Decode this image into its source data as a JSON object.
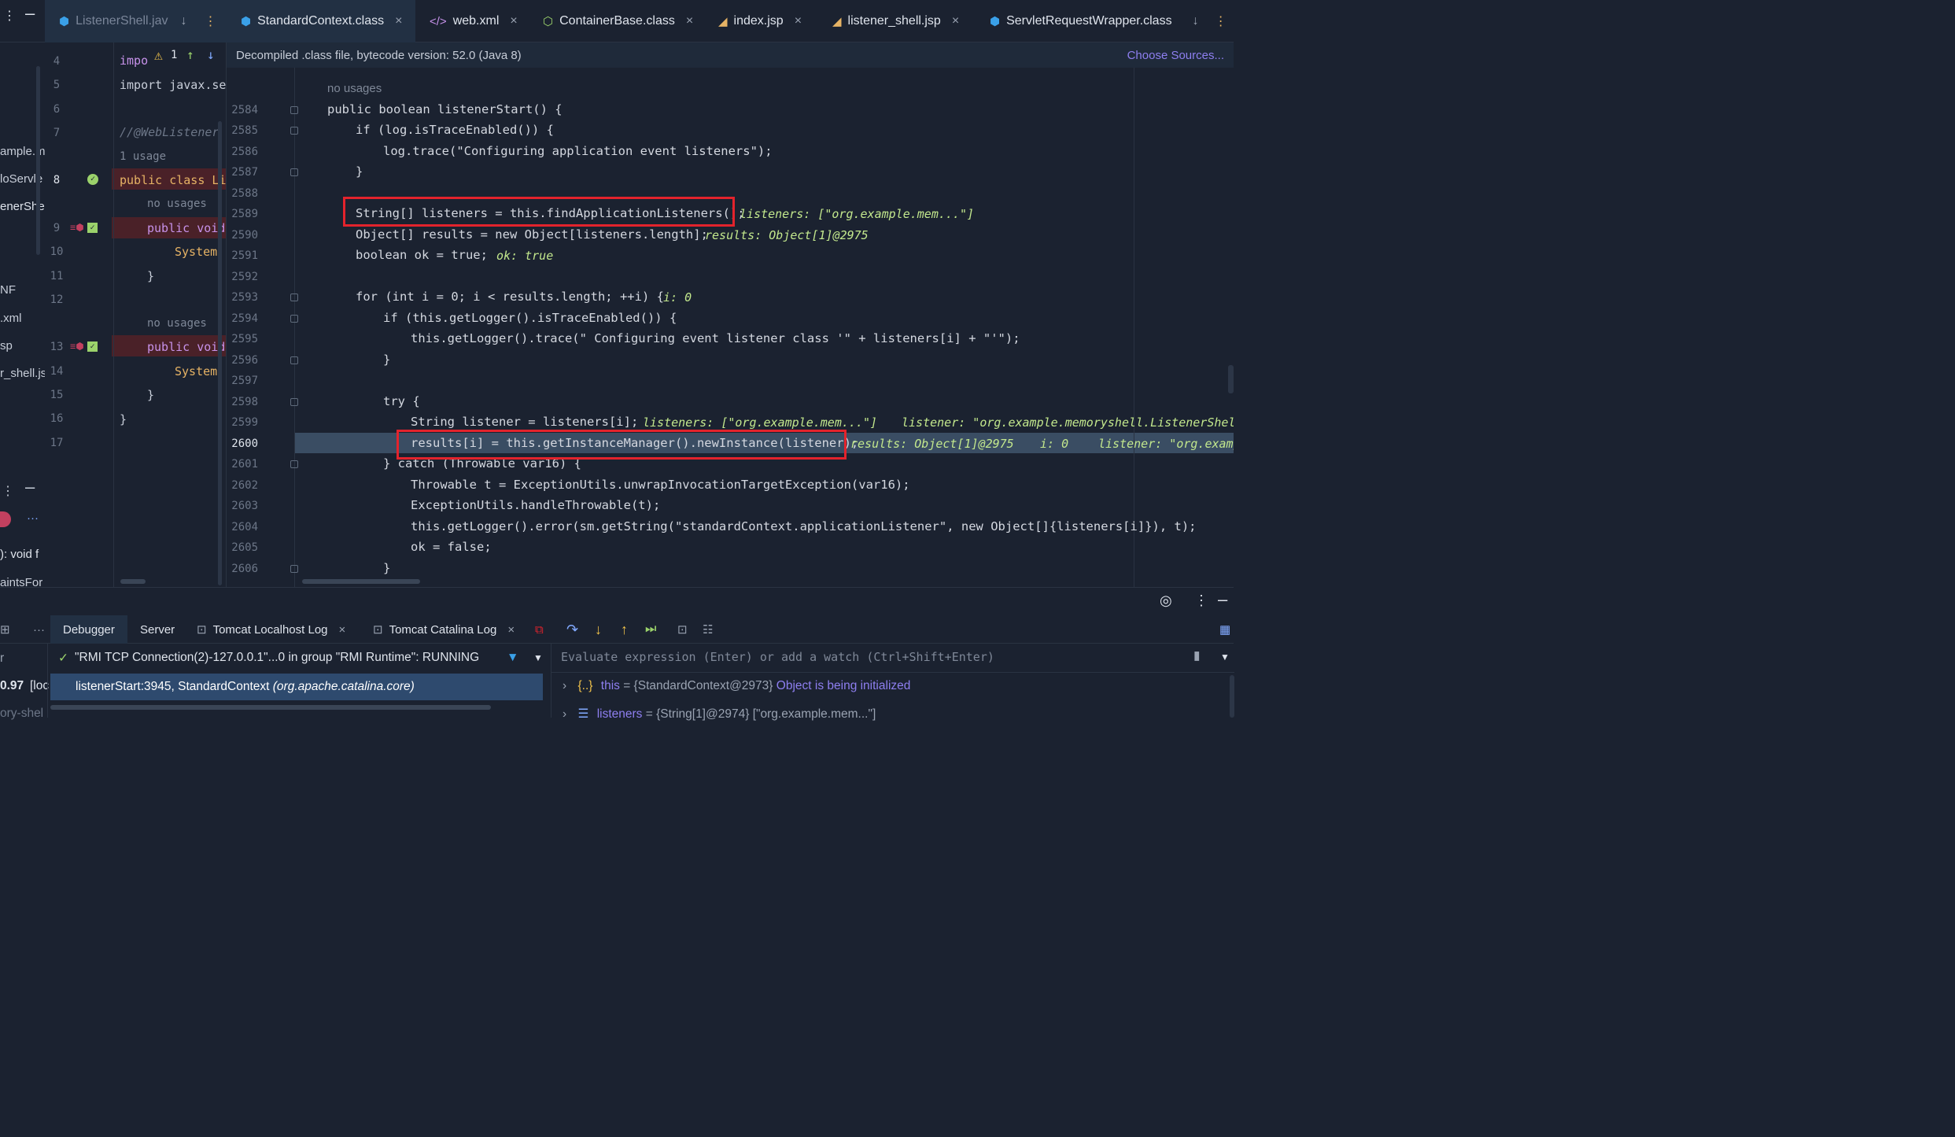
{
  "tabs": [
    {
      "label": "ListenerShell.jav",
      "icon": "class-icon"
    },
    {
      "label": "StandardContext.class",
      "icon": "class-icon"
    },
    {
      "label": "web.xml",
      "icon": "xml-icon"
    },
    {
      "label": "ContainerBase.class",
      "icon": "class-outline-icon"
    },
    {
      "label": "index.jsp",
      "icon": "jsp-icon"
    },
    {
      "label": "listener_shell.jsp",
      "icon": "jsp-icon"
    },
    {
      "label": "ServletRequestWrapper.class",
      "icon": "class-icon"
    }
  ],
  "infobar": {
    "text": "Decompiled .class file, bytecode version: 52.0 (Java 8)",
    "action": "Choose Sources..."
  },
  "left_project": [
    "ample.m",
    "loServle",
    "enerShe",
    "NF",
    ".xml",
    "sp",
    "r_shell.js",
    "): void f",
    "aintsFor"
  ],
  "left_editor": {
    "line_numbers": [
      "4",
      "5",
      "6",
      "7",
      "8",
      "9",
      "10",
      "11",
      "12",
      "13",
      "14",
      "15",
      "16",
      "17"
    ],
    "lines": {
      "l4": "impo",
      "l4b": "1",
      "l5": "import javax.se",
      "l7": "//@WebListener",
      "usage1": "1 usage",
      "l8": "public class Li",
      "nu1": "no usages",
      "l9": "public void",
      "l10": "System.",
      "l11": "}",
      "nu2": "no usages",
      "l13": "public void",
      "l14": "System.",
      "l15": "}",
      "l16": "}"
    }
  },
  "main_editor": {
    "line_numbers": [
      "2584",
      "2585",
      "2586",
      "2587",
      "2588",
      "2589",
      "2590",
      "2591",
      "2592",
      "2593",
      "2594",
      "2595",
      "2596",
      "2597",
      "2598",
      "2599",
      "2600",
      "2601",
      "2602",
      "2603",
      "2604",
      "2605",
      "2606"
    ],
    "no_usages": "no usages",
    "code": {
      "c2584": "public boolean listenerStart() {",
      "c2585": "if (log.isTraceEnabled()) {",
      "c2586": "log.trace(\"Configuring application event listeners\");",
      "c2587": "}",
      "c2589": "String[] listeners = this.findApplicationListeners();",
      "c2590": "Object[] results = new Object[listeners.length];",
      "c2591": "boolean ok = true;",
      "c2593": "for (int i = 0; i < results.length; ++i) {",
      "c2594": "if (this.getLogger().isTraceEnabled()) {",
      "c2595": "this.getLogger().trace(\" Configuring event listener class '\" + listeners[i] + \"'\");",
      "c2596": "}",
      "c2598": "try {",
      "c2599": "String listener = listeners[i];",
      "c2600": "results[i] = this.getInstanceManager().newInstance(listener);",
      "c2601": "} catch (Throwable var16) {",
      "c2602": "Throwable t = ExceptionUtils.unwrapInvocationTargetException(var16);",
      "c2603": "ExceptionUtils.handleThrowable(t);",
      "c2604": "this.getLogger().error(sm.getString(\"standardContext.applicationListener\", new Object[]{listeners[i]}), t);",
      "c2605": "ok = false;",
      "c2606": "}"
    },
    "inline_values": {
      "v2589": "listeners: [\"org.example.mem...\"]",
      "v2590": "results: Object[1]@2975",
      "v2591": "ok: true",
      "v2593": "i: 0",
      "v2599a": "listeners: [\"org.example.mem...\"]",
      "v2599b": "listener: \"org.example.memoryshell.ListenerShell",
      "v2600a": "results: Object[1]@2975",
      "v2600b": "i: 0",
      "v2600c": "listener: \"org.examp"
    }
  },
  "debug_tabs": [
    "Debugger",
    "Server",
    "Tomcat Localhost Log",
    "Tomcat Catalina Log"
  ],
  "thread": "\"RMI TCP Connection(2)-127.0.0.1\"...0 in group \"RMI Runtime\": RUNNING",
  "frame": {
    "method": "listenerStart:3945, StandardContext",
    "pkg": "(org.apache.catalina.core)"
  },
  "left_frames_partial": {
    "a": "r",
    "b": "0.97",
    "c": "[loc",
    "d": "ory-shel"
  },
  "evaluate_placeholder": "Evaluate expression (Enter) or add a watch (Ctrl+Shift+Enter)",
  "variables": [
    {
      "name": "this",
      "value": "= {StandardContext@2973}",
      "note": "Object is being initialized"
    },
    {
      "name": "listeners",
      "value": "= {String[1]@2974} [\"org.example.mem...\"]"
    }
  ]
}
